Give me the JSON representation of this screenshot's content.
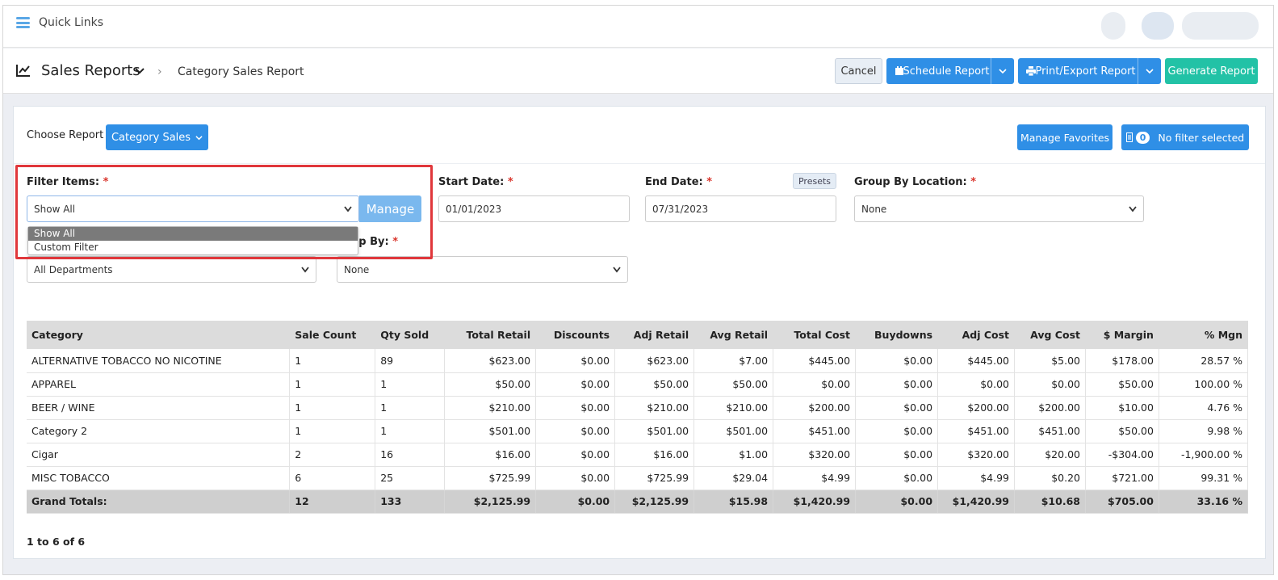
{
  "topbar": {
    "quick_links": "Quick Links"
  },
  "header": {
    "title": "Sales Reports",
    "breadcrumb": "Category Sales Report",
    "cancel": "Cancel",
    "schedule": "Schedule Report",
    "print_export": "Print/Export Report",
    "generate": "Generate Report"
  },
  "colors": {
    "primary": "#2f8fe6",
    "accent": "#22c2a6",
    "highlight": "#e0373b"
  },
  "report": {
    "choose_label": "Choose Report",
    "selected_report": "Category Sales",
    "manage_favorites": "Manage Favorites",
    "filter_count": "0",
    "no_filter": "No filter selected"
  },
  "filters": {
    "filter_items_label": "Filter Items:",
    "filter_items_value": "Show All",
    "manage": "Manage",
    "options": [
      "Show All",
      "Custom Filter"
    ],
    "start_label": "Start Date:",
    "start_value": "01/01/2023",
    "end_label": "End Date:",
    "end_value": "07/31/2023",
    "presets": "Presets",
    "group_location_label": "Group By Location:",
    "group_location_value": "None",
    "department_value": "All Departments",
    "group_by_label_partial": "up By:",
    "group_by_value": "None",
    "required_mark": "*"
  },
  "table": {
    "columns": [
      "Category",
      "Sale Count",
      "Qty Sold",
      "Total Retail",
      "Discounts",
      "Adj Retail",
      "Avg Retail",
      "Total Cost",
      "Buydowns",
      "Adj Cost",
      "Avg Cost",
      "$ Margin",
      "% Mgn"
    ],
    "rows": [
      [
        "ALTERNATIVE TOBACCO NO NICOTINE",
        "1",
        "89",
        "$623.00",
        "$0.00",
        "$623.00",
        "$7.00",
        "$445.00",
        "$0.00",
        "$445.00",
        "$5.00",
        "$178.00",
        "28.57 %"
      ],
      [
        "APPAREL",
        "1",
        "1",
        "$50.00",
        "$0.00",
        "$50.00",
        "$50.00",
        "$0.00",
        "$0.00",
        "$0.00",
        "$0.00",
        "$50.00",
        "100.00 %"
      ],
      [
        "BEER / WINE",
        "1",
        "1",
        "$210.00",
        "$0.00",
        "$210.00",
        "$210.00",
        "$200.00",
        "$0.00",
        "$200.00",
        "$200.00",
        "$10.00",
        "4.76 %"
      ],
      [
        "Category 2",
        "1",
        "1",
        "$501.00",
        "$0.00",
        "$501.00",
        "$501.00",
        "$451.00",
        "$0.00",
        "$451.00",
        "$451.00",
        "$50.00",
        "9.98 %"
      ],
      [
        "Cigar",
        "2",
        "16",
        "$16.00",
        "$0.00",
        "$16.00",
        "$1.00",
        "$320.00",
        "$0.00",
        "$320.00",
        "$20.00",
        "-$304.00",
        "-1,900.00 %"
      ],
      [
        "MISC TOBACCO",
        "6",
        "25",
        "$725.99",
        "$0.00",
        "$725.99",
        "$29.04",
        "$4.99",
        "$0.00",
        "$4.99",
        "$0.20",
        "$721.00",
        "99.31 %"
      ]
    ],
    "totals": [
      "Grand Totals:",
      "12",
      "133",
      "$2,125.99",
      "$0.00",
      "$2,125.99",
      "$15.98",
      "$1,420.99",
      "$0.00",
      "$1,420.99",
      "$10.68",
      "$705.00",
      "33.16 %"
    ]
  },
  "pager": "1 to 6 of 6"
}
